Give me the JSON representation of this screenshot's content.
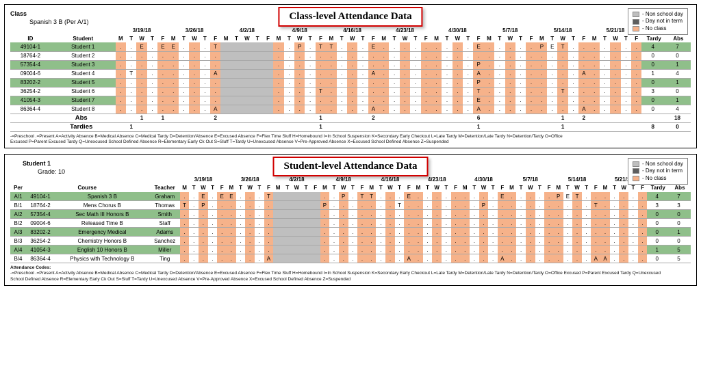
{
  "legend": {
    "non": "- Non school day",
    "notterm": "- Day not in term",
    "noclass": "- No class"
  },
  "weeks": [
    "3/19/18",
    "3/26/18",
    "4/2/18",
    "4/9/18",
    "4/16/18",
    "4/23/18",
    "4/30/18",
    "5/7/18",
    "5/14/18",
    "5/21/18"
  ],
  "days": [
    "M",
    "T",
    "W",
    "T",
    "F"
  ],
  "col_tardy": "Tardy",
  "col_abs": "Abs",
  "class_panel": {
    "title": "Class-level Attendance Data",
    "label_class": "Class",
    "class_name": "Spanish 3 B  (Per A/1)",
    "col_id": "ID",
    "col_student": "Student",
    "totals_abs_label": "Abs",
    "totals_tardies_label": "Tardies",
    "rows": [
      {
        "hl": true,
        "id": "49104-1",
        "name": "Student 1",
        "marks": [
          ".",
          ".",
          "E",
          ".",
          "E",
          "E",
          ".",
          ".",
          ".",
          "T",
          "",
          "",
          "",
          "",
          "",
          ".",
          ".",
          "P",
          ".",
          "T",
          "T",
          ".",
          ".",
          ".",
          "E",
          ".",
          ".",
          ".",
          ".",
          ".",
          ".",
          ".",
          ".",
          ".",
          "E",
          ".",
          ".",
          ".",
          ".",
          ".",
          "P",
          "E",
          "T",
          ".",
          ".",
          ".",
          ".",
          ".",
          ".",
          "."
        ],
        "tardy": "4",
        "abs": "7"
      },
      {
        "hl": false,
        "id": "18764-2",
        "name": "Student 2",
        "marks": [
          ".",
          ".",
          ".",
          ".",
          ".",
          ".",
          ".",
          ".",
          ".",
          ".",
          "",
          "",
          "",
          "",
          "",
          ".",
          ".",
          ".",
          ".",
          ".",
          ".",
          ".",
          ".",
          ".",
          ".",
          ".",
          ".",
          ".",
          ".",
          ".",
          ".",
          ".",
          ".",
          ".",
          ".",
          ".",
          ".",
          ".",
          ".",
          ".",
          ".",
          ".",
          ".",
          ".",
          ".",
          ".",
          ".",
          ".",
          ".",
          "."
        ],
        "tardy": "0",
        "abs": "0"
      },
      {
        "hl": true,
        "id": "57354-4",
        "name": "Student 3",
        "marks": [
          ".",
          ".",
          ".",
          ".",
          ".",
          ".",
          ".",
          ".",
          ".",
          ".",
          "",
          "",
          "",
          "",
          "",
          ".",
          ".",
          ".",
          ".",
          ".",
          ".",
          ".",
          ".",
          ".",
          ".",
          ".",
          ".",
          ".",
          ".",
          ".",
          ".",
          ".",
          ".",
          ".",
          "P",
          ".",
          ".",
          ".",
          ".",
          ".",
          ".",
          ".",
          ".",
          ".",
          ".",
          ".",
          ".",
          ".",
          ".",
          "."
        ],
        "tardy": "0",
        "abs": "1"
      },
      {
        "hl": false,
        "id": "09004-6",
        "name": "Student 4",
        "marks": [
          ".",
          "T",
          ".",
          ".",
          ".",
          ".",
          ".",
          ".",
          ".",
          "A",
          "",
          "",
          "",
          "",
          "",
          ".",
          ".",
          ".",
          ".",
          ".",
          ".",
          ".",
          ".",
          ".",
          "A",
          ".",
          ".",
          ".",
          ".",
          ".",
          ".",
          ".",
          ".",
          ".",
          "A",
          ".",
          ".",
          ".",
          ".",
          ".",
          ".",
          ".",
          ".",
          ".",
          "A",
          ".",
          ".",
          ".",
          ".",
          "."
        ],
        "tardy": "1",
        "abs": "4"
      },
      {
        "hl": true,
        "id": "83202-2",
        "name": "Student 5",
        "marks": [
          ".",
          ".",
          ".",
          ".",
          ".",
          ".",
          ".",
          ".",
          ".",
          ".",
          "",
          "",
          "",
          "",
          "",
          ".",
          ".",
          ".",
          ".",
          ".",
          ".",
          ".",
          ".",
          ".",
          ".",
          ".",
          ".",
          ".",
          ".",
          ".",
          ".",
          ".",
          ".",
          ".",
          "P",
          ".",
          ".",
          ".",
          ".",
          ".",
          ".",
          ".",
          ".",
          ".",
          ".",
          ".",
          ".",
          ".",
          ".",
          "."
        ],
        "tardy": "0",
        "abs": "1"
      },
      {
        "hl": false,
        "id": "36254-2",
        "name": "Student 6",
        "marks": [
          ".",
          ".",
          ".",
          ".",
          ".",
          ".",
          ".",
          ".",
          ".",
          ".",
          "",
          "",
          "",
          "",
          "",
          ".",
          ".",
          ".",
          ".",
          "T",
          ".",
          ".",
          ".",
          ".",
          ".",
          ".",
          ".",
          ".",
          ".",
          ".",
          ".",
          ".",
          ".",
          ".",
          "T",
          ".",
          ".",
          ".",
          ".",
          ".",
          ".",
          ".",
          "T",
          ".",
          ".",
          ".",
          ".",
          ".",
          ".",
          "."
        ],
        "tardy": "3",
        "abs": "0"
      },
      {
        "hl": true,
        "id": "41054-3",
        "name": "Student 7",
        "marks": [
          ".",
          ".",
          ".",
          ".",
          ".",
          ".",
          ".",
          ".",
          ".",
          ".",
          "",
          "",
          "",
          "",
          "",
          ".",
          ".",
          ".",
          ".",
          ".",
          ".",
          ".",
          ".",
          ".",
          ".",
          ".",
          ".",
          ".",
          ".",
          ".",
          ".",
          ".",
          ".",
          ".",
          "E",
          ".",
          ".",
          ".",
          ".",
          ".",
          ".",
          ".",
          ".",
          ".",
          ".",
          ".",
          ".",
          ".",
          ".",
          "."
        ],
        "tardy": "0",
        "abs": "1"
      },
      {
        "hl": false,
        "id": "86364-4",
        "name": "Student 8",
        "marks": [
          ".",
          ".",
          ".",
          ".",
          ".",
          ".",
          ".",
          ".",
          ".",
          "A",
          "",
          "",
          "",
          "",
          "",
          ".",
          ".",
          ".",
          ".",
          ".",
          ".",
          ".",
          ".",
          ".",
          "A",
          ".",
          ".",
          ".",
          ".",
          ".",
          ".",
          ".",
          ".",
          ".",
          "A",
          ".",
          ".",
          ".",
          ".",
          ".",
          ".",
          ".",
          ".",
          ".",
          "A",
          ".",
          ".",
          ".",
          ".",
          "."
        ],
        "tardy": "0",
        "abs": "4"
      }
    ],
    "totals_abs": [
      "",
      "",
      "1",
      "",
      "1",
      "",
      "",
      "",
      "",
      "2",
      "",
      "",
      "",
      "",
      "",
      "",
      "",
      "",
      "",
      "1",
      "",
      "",
      "",
      "",
      "2",
      "",
      "",
      "",
      "",
      "",
      "",
      "",
      "",
      "",
      "6",
      "",
      "",
      "",
      "",
      "",
      "",
      "",
      "1",
      "",
      "2",
      "",
      "",
      "",
      "",
      ""
    ],
    "totals_tardies": [
      "",
      "1",
      "",
      "",
      "",
      "",
      "",
      "",
      "",
      "",
      "",
      "",
      "",
      "",
      "",
      "",
      "",
      "",
      "",
      "1",
      "",
      "",
      "",
      "",
      "",
      "",
      "",
      "",
      "",
      "",
      "",
      "",
      "",
      "",
      "1",
      "",
      "",
      "",
      "",
      "",
      "",
      "",
      "1",
      "",
      "",
      "",
      "",
      "",
      "",
      ""
    ],
    "totals_tardy_sum": "8",
    "totals_abs_sum": "18",
    "totals_abs_blank_tardy": "",
    "totals_tardies_blank_abs": "0",
    "codes1": "-=Preschool   .=Present   A=Activity Absence   B=Medical Absence   C=Medical Tardy   D=Detention/Absence   E=Excused Absence   F=Flex Time Sluff   H=Homebound   I=In School Suspension   K=Secondary Early Checkout   L=Late Tardy   M=Detention/Late Tardy   N=Detention/Tardy   O=Office",
    "codes2": "Excused   P=Parent Excused Tardy   Q=Unexcused School Defined Absence   R=Elementary Early Ck Out   S=Sluff   T=Tardy   U=Unexcused Absence   V=Pre-Approved Absence   X=Excused School Defined Absence   Z=Suspended"
  },
  "student_panel": {
    "title": "Student-level Attendance Data",
    "label_student": "Student 1",
    "label_grade": "Grade:  10",
    "col_per": "Per",
    "col_course": "Course",
    "col_teacher": "Teacher",
    "rows": [
      {
        "hl": true,
        "per": "A/1",
        "id": "49104-1",
        "course": "Spanish 3 B",
        "teacher": "Graham",
        "marks": [
          ".",
          ".",
          "E",
          ".",
          "E",
          "E",
          ".",
          ".",
          ".",
          "T",
          "",
          "",
          "",
          "",
          "",
          ".",
          ".",
          "P",
          ".",
          "T",
          "T",
          ".",
          ".",
          ".",
          "E",
          ".",
          ".",
          ".",
          ".",
          ".",
          ".",
          ".",
          ".",
          ".",
          "E",
          ".",
          ".",
          ".",
          ".",
          ".",
          "P",
          "E",
          "T",
          ".",
          ".",
          ".",
          ".",
          ".",
          ".",
          "."
        ],
        "tardy": "4",
        "abs": "7"
      },
      {
        "hl": false,
        "per": "B/1",
        "id": "18764-2",
        "course": "Mens Chorus B",
        "teacher": "Thomas",
        "marks": [
          "T",
          ".",
          "P",
          ".",
          ".",
          ".",
          ".",
          ".",
          ".",
          ".",
          "",
          "",
          "",
          "",
          "",
          "P",
          ".",
          ".",
          ".",
          ".",
          ".",
          ".",
          ".",
          "T",
          ".",
          ".",
          ".",
          ".",
          ".",
          ".",
          ".",
          ".",
          "P",
          ".",
          ".",
          ".",
          ".",
          ".",
          ".",
          ".",
          ".",
          ".",
          ".",
          ".",
          "T",
          ".",
          ".",
          ".",
          ".",
          "."
        ],
        "tardy": "3",
        "abs": "3"
      },
      {
        "hl": true,
        "per": "A/2",
        "id": "57354-4",
        "course": "Sec Math III Honors B",
        "teacher": "Smith",
        "marks": [
          ".",
          ".",
          ".",
          ".",
          ".",
          ".",
          ".",
          ".",
          ".",
          ".",
          "",
          "",
          "",
          "",
          "",
          ".",
          ".",
          ".",
          ".",
          ".",
          ".",
          ".",
          ".",
          ".",
          ".",
          ".",
          ".",
          ".",
          ".",
          ".",
          ".",
          ".",
          ".",
          ".",
          ".",
          ".",
          ".",
          ".",
          ".",
          ".",
          ".",
          ".",
          ".",
          ".",
          ".",
          ".",
          ".",
          ".",
          ".",
          "."
        ],
        "tardy": "0",
        "abs": "0"
      },
      {
        "hl": false,
        "per": "B/2",
        "id": "09004-6",
        "course": "Released Time B",
        "teacher": "Staff",
        "marks": [
          ".",
          ".",
          ".",
          ".",
          ".",
          ".",
          ".",
          ".",
          ".",
          ".",
          "",
          "",
          "",
          "",
          "",
          ".",
          ".",
          ".",
          ".",
          ".",
          ".",
          ".",
          ".",
          ".",
          ".",
          ".",
          ".",
          ".",
          ".",
          ".",
          ".",
          ".",
          ".",
          ".",
          ".",
          ".",
          ".",
          ".",
          ".",
          ".",
          ".",
          ".",
          ".",
          ".",
          ".",
          ".",
          ".",
          ".",
          ".",
          "."
        ],
        "tardy": "0",
        "abs": "0"
      },
      {
        "hl": true,
        "per": "A/3",
        "id": "83202-2",
        "course": "Emergency Medical",
        "teacher": "Adams",
        "marks": [
          ".",
          ".",
          ".",
          ".",
          ".",
          ".",
          ".",
          ".",
          ".",
          ".",
          "",
          "",
          "",
          "",
          "",
          ".",
          ".",
          ".",
          ".",
          ".",
          ".",
          ".",
          ".",
          ".",
          ".",
          ".",
          ".",
          ".",
          ".",
          ".",
          ".",
          ".",
          ".",
          ".",
          ".",
          ".",
          ".",
          ".",
          ".",
          ".",
          ".",
          ".",
          ".",
          ".",
          ".",
          ".",
          ".",
          ".",
          ".",
          "."
        ],
        "tardy": "0",
        "abs": "1"
      },
      {
        "hl": false,
        "per": "B/3",
        "id": "36254-2",
        "course": "Chemistry Honors B",
        "teacher": "Sanchez",
        "marks": [
          ".",
          ".",
          ".",
          ".",
          ".",
          ".",
          ".",
          ".",
          ".",
          ".",
          "",
          "",
          "",
          "",
          "",
          ".",
          ".",
          ".",
          ".",
          ".",
          ".",
          ".",
          ".",
          ".",
          ".",
          ".",
          ".",
          ".",
          ".",
          ".",
          ".",
          ".",
          ".",
          ".",
          ".",
          ".",
          ".",
          ".",
          ".",
          ".",
          ".",
          ".",
          ".",
          ".",
          ".",
          ".",
          ".",
          ".",
          ".",
          "."
        ],
        "tardy": "0",
        "abs": "0"
      },
      {
        "hl": true,
        "per": "A/4",
        "id": "41054-3",
        "course": "English 10 Honors B",
        "teacher": "Miller",
        "marks": [
          ".",
          ".",
          ".",
          ".",
          ".",
          ".",
          ".",
          ".",
          ".",
          ".",
          "",
          "",
          "",
          "",
          "",
          ".",
          ".",
          ".",
          ".",
          ".",
          ".",
          ".",
          ".",
          ".",
          ".",
          ".",
          ".",
          ".",
          ".",
          ".",
          ".",
          ".",
          ".",
          ".",
          ".",
          ".",
          ".",
          ".",
          ".",
          ".",
          ".",
          ".",
          ".",
          ".",
          ".",
          ".",
          ".",
          ".",
          ".",
          "."
        ],
        "tardy": "1",
        "abs": "5"
      },
      {
        "hl": false,
        "per": "B/4",
        "id": "86364-4",
        "course": "Physics with Technology B",
        "teacher": "Ting",
        "marks": [
          ".",
          ".",
          ".",
          ".",
          ".",
          ".",
          ".",
          ".",
          ".",
          "A",
          "",
          "",
          "",
          "",
          "",
          ".",
          ".",
          ".",
          ".",
          ".",
          ".",
          ".",
          ".",
          ".",
          "A",
          ".",
          ".",
          ".",
          ".",
          ".",
          ".",
          ".",
          ".",
          ".",
          "A",
          ".",
          ".",
          ".",
          ".",
          ".",
          ".",
          ".",
          ".",
          ".",
          "A",
          "A",
          ".",
          ".",
          ".",
          "."
        ],
        "tardy": "0",
        "abs": "5"
      }
    ],
    "codes_label": "Attendance Codes:",
    "codes1": "-=Preschool   .=Present   A=Activity Absence   B=Medical Absence   C=Medical Tardy   D=Detention/Absence   E=Excused Absence   F=Flex Time Sluff   H=Homebound   I=In School Suspension   K=Secondary Early Checkout   L=Late Tardy   M=Detention/Late Tardy   N=Detention/Tardy   O=Office Excused   P=Parent Excused Tardy   Q=Unexcused",
    "codes2": "School Defined Absence   R=Elementary Early Ck Out   S=Sluff   T=Tardy   U=Unexcused Absence   V=Pre-Approved Absence   X=Excused School Defined Absence   Z=Suspended"
  }
}
